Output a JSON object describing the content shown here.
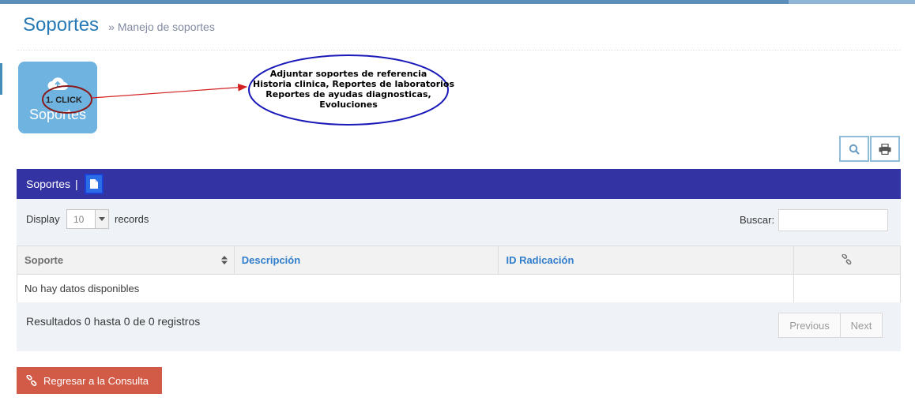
{
  "header": {
    "title": "Soportes",
    "breadcrumb_sep": "»",
    "subtitle": "Manejo de soportes"
  },
  "tile": {
    "label": "Soportes",
    "icon": "cloud-upload-icon"
  },
  "annotation": {
    "click_label": "1. CLICK",
    "callout_lines": [
      "Adjuntar soportes de referencia",
      "Historia clinica, Reportes de laboratorios",
      "Reportes de ayudas diagnosticas,",
      "Evoluciones"
    ],
    "ellipse_color": "#1a1ab8",
    "arrow_color": "#d42020",
    "click_ring_color": "#8b1a1a"
  },
  "tools": {
    "search_icon": "search-icon",
    "print_icon": "print-icon"
  },
  "panel": {
    "title": "Soportes",
    "separator": "|",
    "color": "#3333a4"
  },
  "toolbar": {
    "display_label": "Display",
    "records_value": "10",
    "records_label": "records",
    "search_label": "Buscar:",
    "search_value": ""
  },
  "table": {
    "columns": [
      "Soporte",
      "Descripción",
      "ID Radicación",
      "link-icon"
    ],
    "empty_text": "No hay datos disponibles"
  },
  "footer": {
    "results_text": "Resultados 0 hasta 0 de 0 registros",
    "previous": "Previous",
    "next": "Next"
  },
  "back_button": {
    "label": "Regresar a la Consulta",
    "color": "#d15b47"
  }
}
